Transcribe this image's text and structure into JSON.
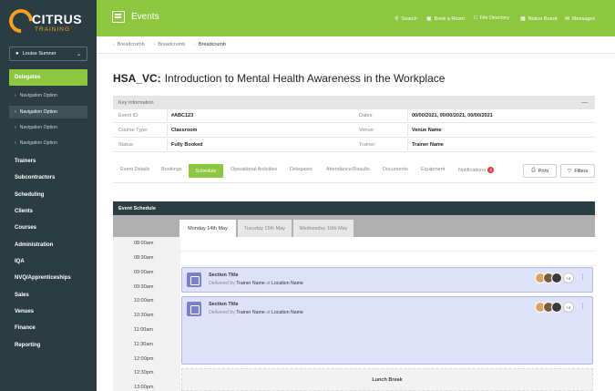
{
  "brand": {
    "name": "CITRUS",
    "sub": "TRAINING"
  },
  "user": {
    "name": "Louise Sumner"
  },
  "sidebar": {
    "active": "Delegates",
    "sub_items": [
      "Navigation Option",
      "Navigation Option",
      "Navigation Option",
      "Navigation Option"
    ],
    "items": [
      "Trainers",
      "Subcontractors",
      "Scheduling",
      "Clients",
      "Courses",
      "Administration",
      "IQA",
      "NVQ/Apprenticeships",
      "Sales",
      "Venues",
      "Finance",
      "Reporting"
    ]
  },
  "header": {
    "title": "Events",
    "links": [
      "Search",
      "Book a Room",
      "File Directory",
      "Notice Board",
      "Messages"
    ]
  },
  "breadcrumbs": [
    "Breadcrumb",
    "Breadcrumb",
    "Breadcrumb"
  ],
  "page": {
    "code": "HSA_VC:",
    "title": "Introduction to Mental Health Awareness in the Workplace"
  },
  "key_info": {
    "heading": "Key Information",
    "collapse": "—",
    "rows": [
      {
        "l1": "Event ID:",
        "v1": "#ABC123",
        "l2": "Dates:",
        "v2": "00/00/2021, 00/00/2021, 00/00/2021"
      },
      {
        "l1": "Course Type:",
        "v1": "Classroom",
        "l2": "Venue:",
        "v2": "Venue Name"
      },
      {
        "l1": "Status:",
        "v1": "Fully Booked",
        "l2": "Trainer:",
        "v2": "Trainer Name"
      }
    ]
  },
  "tabs": {
    "items": [
      "Event Details",
      "Bookings",
      "Schedule",
      "Operational Activities",
      "Delegates",
      "Attendance/Results",
      "Documents",
      "Equipment",
      "Notifications"
    ],
    "notifications_count": "3",
    "print": "Print",
    "filters": "Filters"
  },
  "schedule": {
    "heading": "Event Schedule",
    "days": [
      "Monday 14th May",
      "Tuesday 15th May",
      "Wednesday 16th May"
    ],
    "times": [
      "08:00am",
      "08:30am",
      "09:00am",
      "09:30am",
      "10:00am",
      "10:30am",
      "11:00am",
      "11:30am",
      "12:00pm",
      "12:30pm",
      "13:00pm"
    ],
    "events": [
      {
        "title": "Section Title",
        "delivered_by": "Delivered by",
        "trainer": "Trainer Name",
        "at": "at",
        "location": "Location Name",
        "more": "+4"
      },
      {
        "title": "Section Title",
        "delivered_by": "Delivered by",
        "trainer": "Trainer Name",
        "at": "at",
        "location": "Location Name",
        "more": "+4"
      }
    ],
    "lunch": "Lunch Break"
  }
}
